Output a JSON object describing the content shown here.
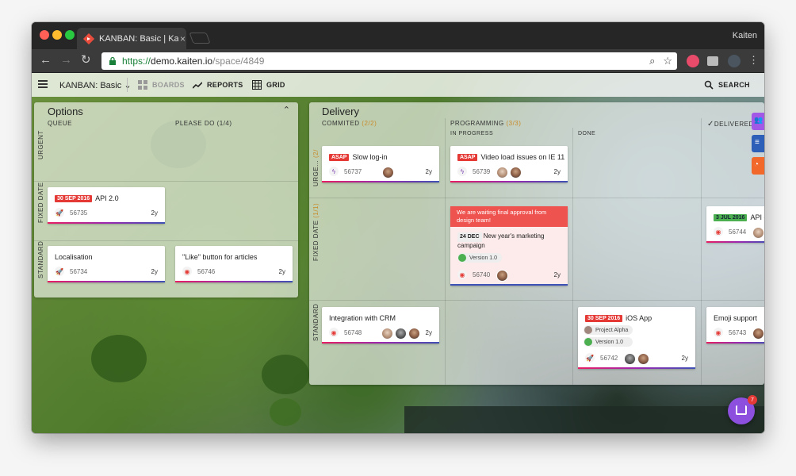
{
  "browser": {
    "tab_title": "KANBAN: Basic | Kaiten",
    "tab_close": "×",
    "user_name": "Kaiten",
    "url_scheme": "https://",
    "url_host": "demo.kaiten.io",
    "url_path": "/space/4849"
  },
  "header": {
    "space_name": "KANBAN: Basic",
    "boards_label": "BOARDS",
    "reports_label": "REPORTS",
    "grid_label": "GRID",
    "search_label": "SEARCH"
  },
  "options_board": {
    "title": "Options",
    "columns": [
      "QUEUE",
      "PLEASE DO (1/4)"
    ],
    "lanes": [
      "URGENT",
      "FIXED DATE",
      "STANDARD"
    ],
    "cards": {
      "api": {
        "date": "30 SEP 2016",
        "title": "API 2.0",
        "id": "56735",
        "age": "2y"
      },
      "localisation": {
        "title": "Localisation",
        "id": "56734",
        "age": "2y"
      },
      "like": {
        "title": "\"Like\" button for articles",
        "id": "56746",
        "age": "2y"
      }
    }
  },
  "delivery_board": {
    "title": "Delivery",
    "commited_label": "COMMITED",
    "commited_count": "(2/2)",
    "programming_label": "PROGRAMMING",
    "programming_count": "(3/3)",
    "in_progress_label": "IN PROGRESS",
    "done_label": "DONE",
    "delivered_label": "DELIVERED",
    "lanes": {
      "urgent": "URGE...",
      "urgent_count": "(2/",
      "fixed": "FIXED DATE",
      "fixed_count": "(1/1)",
      "standard": "STANDARD"
    },
    "cards": {
      "slow_login": {
        "badge": "ASAP",
        "title": "Slow log-in",
        "id": "56737",
        "age": "2y"
      },
      "video_ie": {
        "badge": "ASAP",
        "title": "Video load issues on IE 11",
        "id": "56739",
        "age": "2y"
      },
      "newyear": {
        "banner": "We are waiting final approval from design team!",
        "date": "24 DEC",
        "title": "New year's marketing campaign",
        "tag": "Version 1.0",
        "id": "56740",
        "age": "2y"
      },
      "api_docs": {
        "date": "3 JUL 2016",
        "title": "API doc",
        "id": "56744"
      },
      "crm": {
        "title": "Integration with CRM",
        "id": "56748",
        "age": "2y"
      },
      "ios": {
        "date": "30 SEP 2016",
        "title": "iOS App",
        "tag1": "Project Alpha",
        "tag2": "Version 1.0",
        "id": "56742",
        "age": "2y"
      },
      "emoji": {
        "title": "Emoji support",
        "id": "56743"
      }
    }
  },
  "chat": {
    "badge": "7"
  },
  "colors": {
    "accent_red": "#e53935",
    "accent_green": "#4caf50",
    "accent_purple": "#8c4fde",
    "count_orange": "#c98b2a"
  }
}
